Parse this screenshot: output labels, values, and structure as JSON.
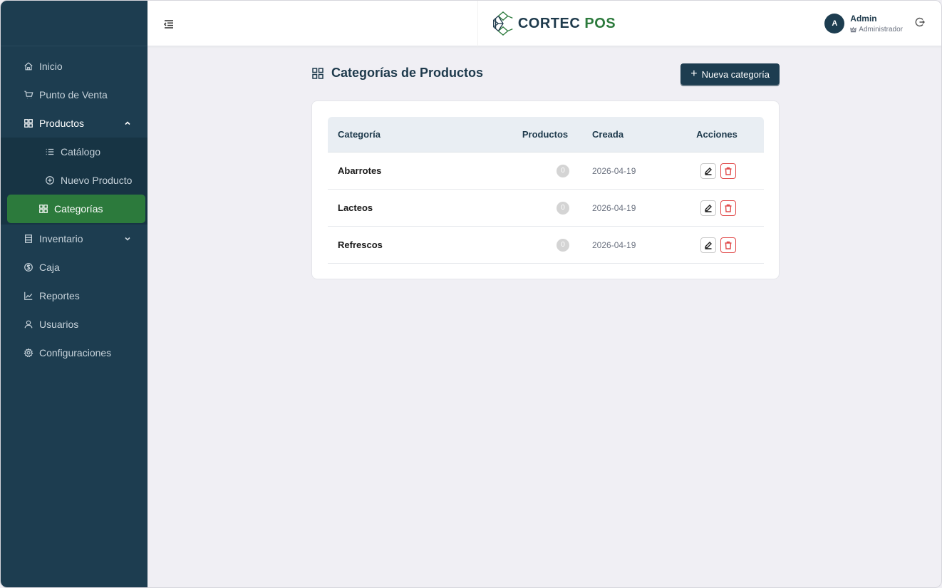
{
  "app": {
    "brand_part1": "CORTEC",
    "brand_part2": "POS"
  },
  "colors": {
    "sidebar": "#1d3d50",
    "active": "#2c7a3c",
    "accent": "#1e3a4c",
    "danger": "#e14b4b"
  },
  "user": {
    "initial": "A",
    "name": "Admin",
    "role": "Administrador"
  },
  "sidebar": {
    "items": [
      {
        "label": "Inicio",
        "icon": "home-icon"
      },
      {
        "label": "Punto de Venta",
        "icon": "cart-icon"
      },
      {
        "label": "Productos",
        "icon": "grid-icon"
      },
      {
        "label": "Inventario",
        "icon": "clipboard-icon"
      },
      {
        "label": "Caja",
        "icon": "dollar-icon"
      },
      {
        "label": "Reportes",
        "icon": "chart-icon"
      },
      {
        "label": "Usuarios",
        "icon": "user-icon"
      },
      {
        "label": "Configuraciones",
        "icon": "gear-icon"
      }
    ],
    "submenu": [
      {
        "label": "Catálogo",
        "icon": "list-icon"
      },
      {
        "label": "Nuevo Producto",
        "icon": "plus-circle-icon"
      },
      {
        "label": "Categorías",
        "icon": "grid-icon"
      }
    ]
  },
  "page": {
    "title": "Categorías de Productos",
    "new_button": "Nueva categoría",
    "new_button_plus": "+"
  },
  "table": {
    "headers": [
      "Categoría",
      "Productos",
      "Creada",
      "Acciones"
    ],
    "rows": [
      {
        "name": "Abarrotes",
        "count": "0",
        "created": "2026-04-19"
      },
      {
        "name": "Lacteos",
        "count": "0",
        "created": "2026-04-19"
      },
      {
        "name": "Refrescos",
        "count": "0",
        "created": "2026-04-19"
      }
    ]
  }
}
